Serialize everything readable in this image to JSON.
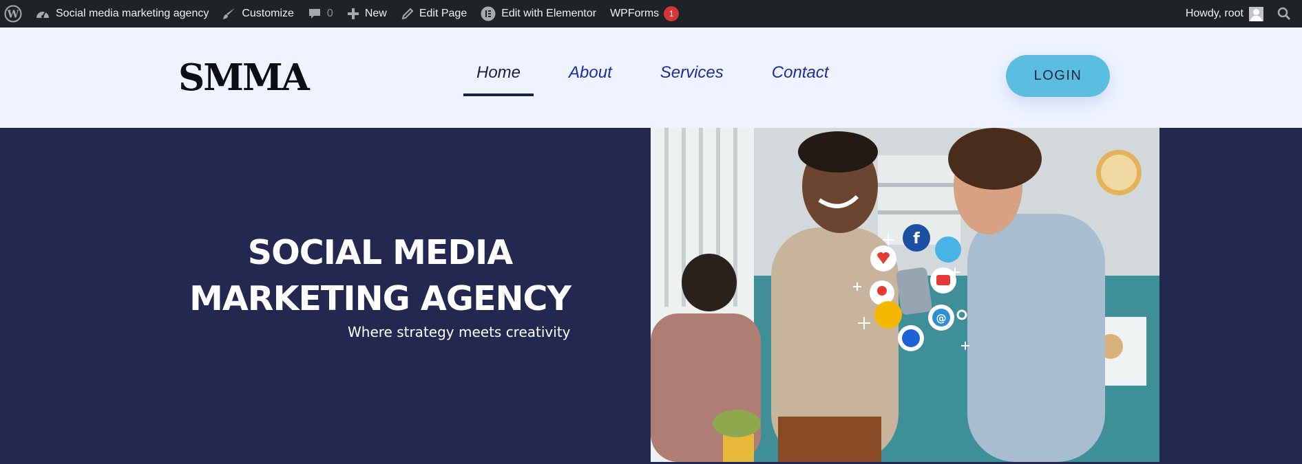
{
  "adminbar": {
    "site_name": "Social media marketing agency",
    "customize": "Customize",
    "comments_count": "0",
    "new": "New",
    "edit_page": "Edit Page",
    "edit_elementor": "Edit with Elementor",
    "wpforms": "WPForms",
    "wpforms_badge": "1",
    "howdy": "Howdy, root"
  },
  "header": {
    "logo": "SMMA",
    "nav": [
      {
        "label": "Home",
        "active": true
      },
      {
        "label": "About"
      },
      {
        "label": "Services"
      },
      {
        "label": "Contact"
      }
    ],
    "login": "LOGIN"
  },
  "hero": {
    "title_line1": "SOCIAL MEDIA",
    "title_line2": "MARKETING AGENCY",
    "subtitle": "Where strategy meets creativity"
  },
  "colors": {
    "adminbar_bg": "#1d2327",
    "header_bg": "#eef3ff",
    "hero_bg": "#232851",
    "login_bg": "#5bbde0",
    "nav_link": "#1e2da0"
  }
}
